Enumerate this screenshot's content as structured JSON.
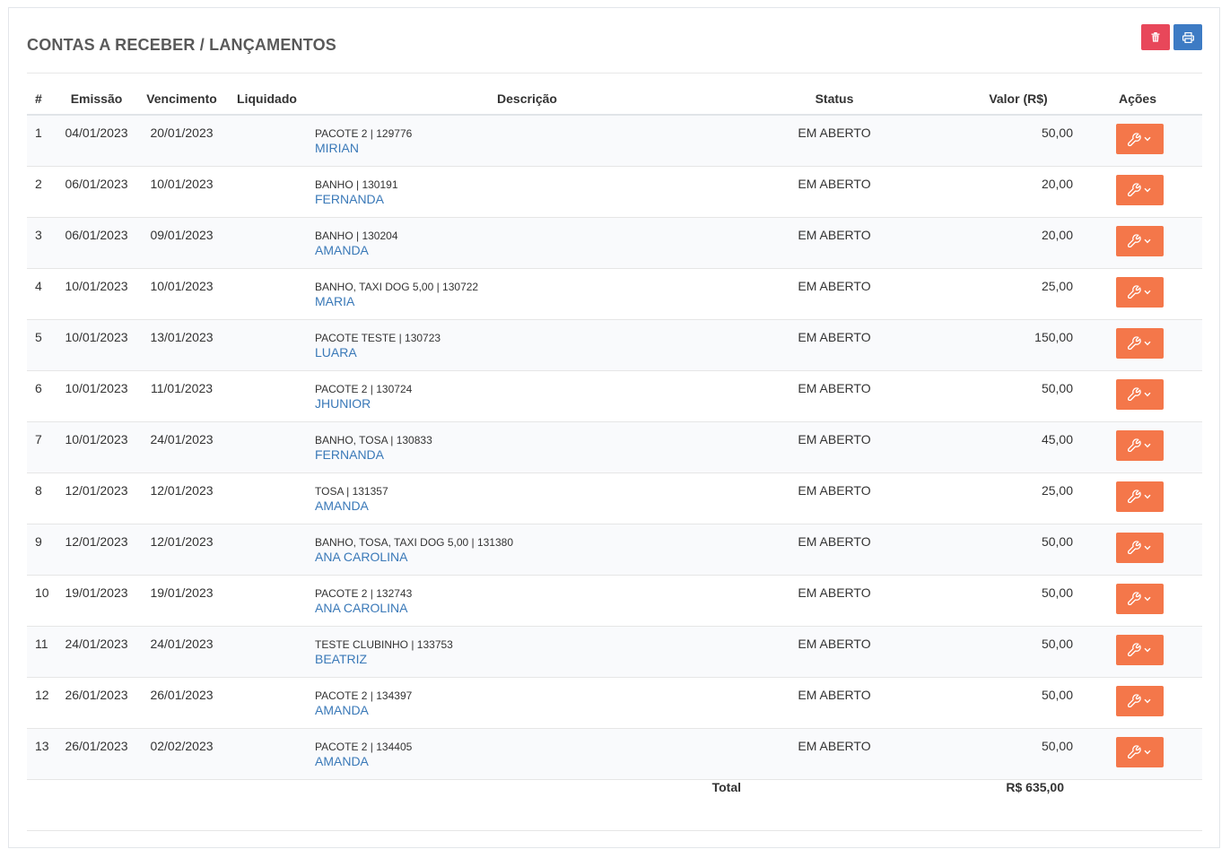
{
  "page": {
    "title": "CONTAS A RECEBER / LANÇAMENTOS"
  },
  "toolbar": {
    "delete_icon": "trash-icon",
    "print_icon": "printer-icon",
    "delete_color": "#e8475a",
    "print_color": "#3d7bc4"
  },
  "table": {
    "headers": {
      "num": "#",
      "emissao": "Emissão",
      "vencimento": "Vencimento",
      "liquidado": "Liquidado",
      "descricao": "Descrição",
      "status": "Status",
      "valor": "Valor (R$)",
      "acoes": "Ações"
    },
    "action_color": "#f4774a",
    "action_icon": "wrench-icon",
    "rows": [
      {
        "num": "1",
        "emissao": "04/01/2023",
        "vencimento": "20/01/2023",
        "liquidado": "",
        "descricao": "PACOTE 2 | 129776",
        "cliente": "MIRIAN",
        "status": "EM ABERTO",
        "valor": "50,00"
      },
      {
        "num": "2",
        "emissao": "06/01/2023",
        "vencimento": "10/01/2023",
        "liquidado": "",
        "descricao": "BANHO | 130191",
        "cliente": "FERNANDA",
        "status": "EM ABERTO",
        "valor": "20,00"
      },
      {
        "num": "3",
        "emissao": "06/01/2023",
        "vencimento": "09/01/2023",
        "liquidado": "",
        "descricao": "BANHO | 130204",
        "cliente": "AMANDA",
        "status": "EM ABERTO",
        "valor": "20,00"
      },
      {
        "num": "4",
        "emissao": "10/01/2023",
        "vencimento": "10/01/2023",
        "liquidado": "",
        "descricao": "BANHO, TAXI DOG 5,00 | 130722",
        "cliente": "MARIA",
        "status": "EM ABERTO",
        "valor": "25,00"
      },
      {
        "num": "5",
        "emissao": "10/01/2023",
        "vencimento": "13/01/2023",
        "liquidado": "",
        "descricao": "PACOTE TESTE | 130723",
        "cliente": "LUARA",
        "status": "EM ABERTO",
        "valor": "150,00"
      },
      {
        "num": "6",
        "emissao": "10/01/2023",
        "vencimento": "11/01/2023",
        "liquidado": "",
        "descricao": "PACOTE 2 | 130724",
        "cliente": "JHUNIOR",
        "status": "EM ABERTO",
        "valor": "50,00"
      },
      {
        "num": "7",
        "emissao": "10/01/2023",
        "vencimento": "24/01/2023",
        "liquidado": "",
        "descricao": "BANHO, TOSA | 130833",
        "cliente": "FERNANDA",
        "status": "EM ABERTO",
        "valor": "45,00"
      },
      {
        "num": "8",
        "emissao": "12/01/2023",
        "vencimento": "12/01/2023",
        "liquidado": "",
        "descricao": "TOSA | 131357",
        "cliente": "AMANDA",
        "status": "EM ABERTO",
        "valor": "25,00"
      },
      {
        "num": "9",
        "emissao": "12/01/2023",
        "vencimento": "12/01/2023",
        "liquidado": "",
        "descricao": "BANHO, TOSA, TAXI DOG 5,00 | 131380",
        "cliente": "ANA CAROLINA",
        "status": "EM ABERTO",
        "valor": "50,00"
      },
      {
        "num": "10",
        "emissao": "19/01/2023",
        "vencimento": "19/01/2023",
        "liquidado": "",
        "descricao": "PACOTE 2 | 132743",
        "cliente": "ANA CAROLINA",
        "status": "EM ABERTO",
        "valor": "50,00"
      },
      {
        "num": "11",
        "emissao": "24/01/2023",
        "vencimento": "24/01/2023",
        "liquidado": "",
        "descricao": "TESTE CLUBINHO | 133753",
        "cliente": "BEATRIZ",
        "status": "EM ABERTO",
        "valor": "50,00"
      },
      {
        "num": "12",
        "emissao": "26/01/2023",
        "vencimento": "26/01/2023",
        "liquidado": "",
        "descricao": "PACOTE 2 | 134397",
        "cliente": "AMANDA",
        "status": "EM ABERTO",
        "valor": "50,00"
      },
      {
        "num": "13",
        "emissao": "26/01/2023",
        "vencimento": "02/02/2023",
        "liquidado": "",
        "descricao": "PACOTE 2 | 134405",
        "cliente": "AMANDA",
        "status": "EM ABERTO",
        "valor": "50,00"
      }
    ],
    "total_label": "Total",
    "total_value": "R$ 635,00"
  }
}
